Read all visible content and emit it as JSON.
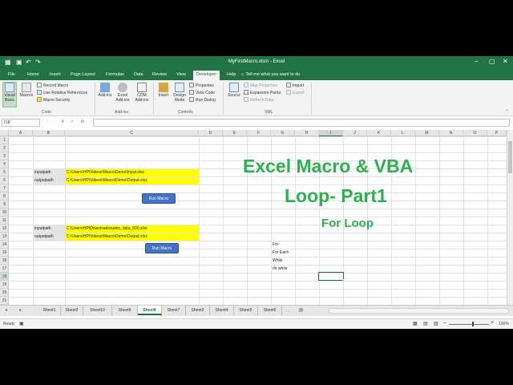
{
  "window": {
    "title": "MyFirstMacro.xlsm  -  Excel"
  },
  "tabs": [
    "File",
    "Home",
    "Insert",
    "Page Layout",
    "Formulas",
    "Data",
    "Review",
    "View",
    "Developer",
    "Help"
  ],
  "active_tab": "Developer",
  "tell_me": "Tell me what you want to do",
  "ribbon": {
    "code": {
      "visual_basic": "Visual Basic",
      "macros": "Macros",
      "record_macro": "Record Macro",
      "use_relative": "Use Relative References",
      "macro_security": "Macro Security",
      "label": "Code"
    },
    "addins": {
      "addins": "Add-ins",
      "excel_addins": "Excel Add-ins",
      "com_addins": "COM Add-ins",
      "label": "Add-ins"
    },
    "controls": {
      "insert": "Insert",
      "design_mode": "Design Mode",
      "properties": "Properties",
      "view_code": "View Code",
      "run_dialog": "Run Dialog",
      "label": "Controls"
    },
    "xml": {
      "source": "Source",
      "map_properties": "Map Properties",
      "expansion_packs": "Expansion Packs",
      "refresh_data": "Refresh Data",
      "import": "Import",
      "export": "Export",
      "label": "XML"
    }
  },
  "formula_bar": {
    "name_box": "I18",
    "fx": "fx",
    "value": ""
  },
  "columns": [
    "A",
    "B",
    "C",
    "D",
    "E",
    "F",
    "G",
    "H",
    "I",
    "J",
    "K",
    "L",
    "M",
    "N",
    "O",
    "P"
  ],
  "selected_column": "I",
  "rows": [
    "1",
    "2",
    "3",
    "4",
    "5",
    "6",
    "7",
    "8",
    "9",
    "10",
    "11",
    "12",
    "13",
    "14",
    "15",
    "16",
    "17",
    "18",
    "19",
    "20",
    "21"
  ],
  "selected_row": "18",
  "cells": {
    "b5": "inputpath",
    "c5": "C:\\Users\\HP\\Videos\\Macro\\Demo\\Input.xlsx",
    "b6": "outputpath",
    "c6": "C:\\Users\\HP\\Videos\\Macro\\Demo\\Output.xlsx",
    "b12": "inputpath",
    "c12": "C:\\Users\\HP\\Downloads\\sales_data_500.xlsx",
    "b13": "outputpath",
    "c13": "C:\\Users\\HP\\Videos\\Macro\\Demo\\Output.xlsx",
    "g14": "For",
    "g15": "For Each",
    "g16": "While",
    "g17": "do while"
  },
  "buttons": {
    "run_macro_1": "Run Macro",
    "run_macro_2": "Run Macro"
  },
  "overlay": {
    "line1": "Excel Macro & VBA",
    "line2": "Loop- Part1",
    "line3": "For Loop"
  },
  "sheets": [
    "Sheet1",
    "Sheet2",
    "Sheet10",
    "Sheet9",
    "Sheet8",
    "Sheet7",
    "Sheet3",
    "Sheet4",
    "Sheet5",
    "Sheet6"
  ],
  "active_sheet": "Sheet8",
  "status": {
    "ready": "Ready",
    "zoom": "100%"
  },
  "colors": {
    "excel_green": "#217346",
    "overlay_green": "#2db14f",
    "highlight": "#ffff00",
    "button_blue": "#4472c4"
  }
}
